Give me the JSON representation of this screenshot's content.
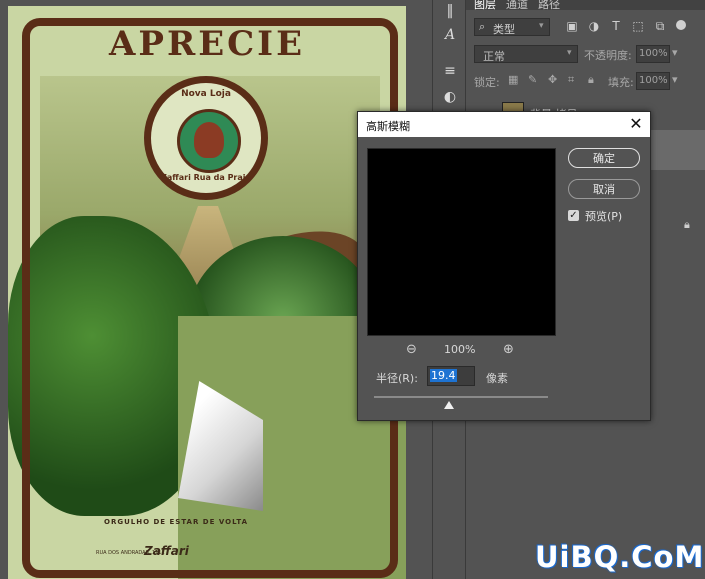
{
  "poster": {
    "title": "APRECIE",
    "emblem_top": "Nova Loja",
    "emblem_bottom": "Zaffari Rua da Praia",
    "footer_text": "ORGULHO DE ESTAR DE VOLTA",
    "footer_small": "RUA DOS ANDRADAS, 1111",
    "footer_brand": "Zaffari"
  },
  "toolbar": {
    "tools": [
      {
        "icon": "collapse-icon",
        "glyph": "‖"
      },
      {
        "icon": "character-icon",
        "glyph": "A"
      },
      {
        "icon": "adjustments-icon",
        "glyph": "≡"
      },
      {
        "icon": "contrast-icon",
        "glyph": "◐"
      }
    ]
  },
  "layers_panel": {
    "tabs": [
      "图层",
      "通道",
      "路径"
    ],
    "filter_kind": "类型",
    "blend_mode": "正常",
    "opacity_label": "不透明度:",
    "opacity_value": "100%",
    "lock_label": "锁定:",
    "fill_label": "填充:",
    "fill_value": "100%",
    "layer_name": "背景 拷贝"
  },
  "dialog": {
    "title": "高斯模糊",
    "ok_label": "确定",
    "cancel_label": "取消",
    "preview_label": "预览(P)",
    "preview_checked": true,
    "zoom_level": "100%",
    "radius_label": "半径(R):",
    "radius_value": "19.4",
    "radius_unit": "像素",
    "slider_fraction": 0.43
  },
  "watermark": "UiBQ.CoM",
  "colors": {
    "panel_bg": "#535353",
    "selection_blue": "#1e73d2",
    "poster_brown": "#5a2d17",
    "poster_green": "#87a05a"
  }
}
